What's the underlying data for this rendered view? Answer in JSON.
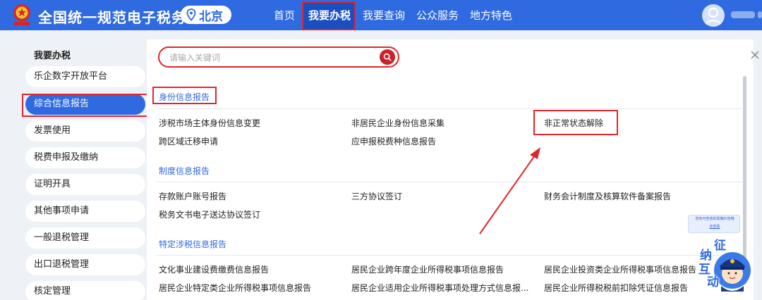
{
  "header": {
    "site_title": "全国统一规范电子税务局",
    "region": "北京",
    "nav": [
      "首页",
      "我要办税",
      "我要查询",
      "公众服务",
      "地方特色"
    ],
    "active_nav": "我要办税"
  },
  "sidebar": {
    "title": "我要办税",
    "items": [
      "乐企数字开放平台",
      "综合信息报告",
      "发票使用",
      "税费申报及缴纳",
      "证明开具",
      "其他事项申请",
      "一般退税管理",
      "出口退税管理",
      "核定管理"
    ],
    "active_item": "综合信息报告"
  },
  "search": {
    "placeholder": "请输入关键词"
  },
  "sections": [
    {
      "title": "身份信息报告",
      "links": [
        "涉税市场主体身份信息变更",
        "非居民企业身份信息采集",
        "非正常状态解除",
        "跨区域迁移申请",
        "应申报税费种信息报告"
      ]
    },
    {
      "title": "制度信息报告",
      "links": [
        "存款账户账号报告",
        "三方协议签订",
        "财务会计制度及核算软件备案报告",
        "税务文书电子送达协议签订"
      ]
    },
    {
      "title": "特定涉税信息报告",
      "links": [
        "文化事业建设费缴费信息报告",
        "居民企业跨年度企业所得税事项信息报告",
        "居民企业投资类企业所得税事项信息报告",
        "居民企业特定类企业所得税事项信息报告",
        "居民企业适用企业所得税事项处理方式信息报...",
        "居民企业所得税税前扣除凭证信息报告"
      ]
    }
  ],
  "widget": {
    "tip_text": "您有可查收的政策红包哦",
    "tip_link": "去查看",
    "mascot_chars": [
      "征",
      "纳",
      "互",
      "动"
    ]
  },
  "colors": {
    "header_blue": "#2f6ae0",
    "nav_active_blue": "#1a4fc2",
    "highlight_red": "#e0262b",
    "search_button_red": "#c8222a"
  }
}
